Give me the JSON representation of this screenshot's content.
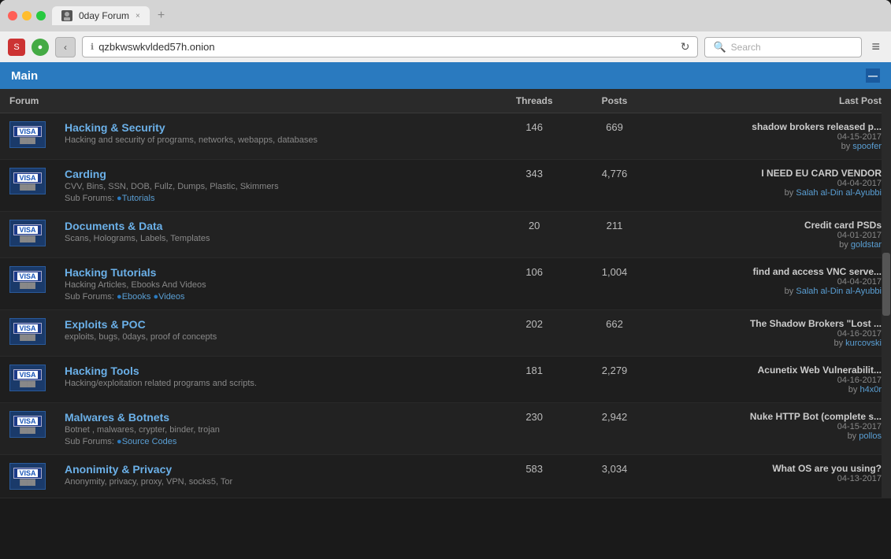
{
  "browser": {
    "tab_title": "0day Forum",
    "tab_close": "×",
    "tab_new": "+",
    "address": "qzbkwswkvlded57h.onion",
    "search_placeholder": "Search",
    "reload_icon": "↻",
    "back_icon": "‹",
    "menu_icon": "≡",
    "lock_icon": "ℹ"
  },
  "page": {
    "main_label": "Main",
    "minimize": "—",
    "columns": {
      "forum": "Forum",
      "threads": "Threads",
      "posts": "Posts",
      "last_post": "Last Post"
    },
    "forums": [
      {
        "name": "Hacking & Security",
        "desc": "Hacking and security of programs, networks, webapps, databases",
        "threads": "146",
        "posts": "669",
        "last_post_title": "shadow brokers released p...",
        "last_post_date": "04-15-2017",
        "last_post_by": "spoofer",
        "sub_forums": []
      },
      {
        "name": "Carding",
        "desc": "CVV, Bins, SSN, DOB, Fullz, Dumps, Plastic, Skimmers",
        "threads": "343",
        "posts": "4,776",
        "last_post_title": "I NEED EU CARD VENDOR",
        "last_post_date": "04-04-2017",
        "last_post_by": "Salah al-Din al-Ayubbi",
        "sub_forums": [
          "Tutorials"
        ]
      },
      {
        "name": "Documents & Data",
        "desc": "Scans, Holograms, Labels, Templates",
        "threads": "20",
        "posts": "211",
        "last_post_title": "Credit card PSDs",
        "last_post_date": "04-01-2017",
        "last_post_by": "goldstar",
        "sub_forums": []
      },
      {
        "name": "Hacking Tutorials",
        "desc": "Hacking Articles, Ebooks And Videos",
        "threads": "106",
        "posts": "1,004",
        "last_post_title": "find and access VNC serve...",
        "last_post_date": "04-04-2017",
        "last_post_by": "Salah al-Din al-Ayubbi",
        "sub_forums": [
          "Ebooks",
          "Videos"
        ]
      },
      {
        "name": "Exploits & POC",
        "desc": "exploits, bugs, 0days, proof of concepts",
        "threads": "202",
        "posts": "662",
        "last_post_title": "The Shadow Brokers \"Lost ...",
        "last_post_date": "04-16-2017",
        "last_post_by": "kurcovski",
        "sub_forums": []
      },
      {
        "name": "Hacking Tools",
        "desc": "Hacking/exploitation related programs and scripts.",
        "threads": "181",
        "posts": "2,279",
        "last_post_title": "Acunetix Web Vulnerabilit...",
        "last_post_date": "04-16-2017",
        "last_post_by": "h4x0r",
        "sub_forums": []
      },
      {
        "name": "Malwares & Botnets",
        "desc": "Botnet , malwares, crypter, binder, trojan",
        "threads": "230",
        "posts": "2,942",
        "last_post_title": "Nuke HTTP Bot (complete s...",
        "last_post_date": "04-15-2017",
        "last_post_by": "pollos",
        "sub_forums": [
          "Source Codes"
        ]
      },
      {
        "name": "Anonimity & Privacy",
        "desc": "Anonymity, privacy, proxy, VPN, socks5, Tor",
        "threads": "583",
        "posts": "3,034",
        "last_post_title": "What OS are you using?",
        "last_post_date": "04-13-2017",
        "last_post_by": "",
        "sub_forums": []
      }
    ]
  }
}
